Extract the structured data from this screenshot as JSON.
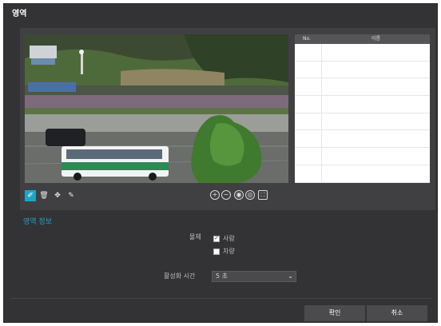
{
  "dialog": {
    "title": "영역"
  },
  "table": {
    "headers": [
      "No.",
      "이름"
    ],
    "rows": [
      [
        "",
        ""
      ],
      [
        "",
        ""
      ],
      [
        "",
        ""
      ],
      [
        "",
        ""
      ],
      [
        "",
        ""
      ],
      [
        "",
        ""
      ],
      [
        "",
        ""
      ],
      [
        "",
        ""
      ]
    ]
  },
  "toolbar": {
    "draw_icon": "✐",
    "delete_icon": "🗑",
    "move_icon": "✥",
    "paint_icon": "✎",
    "zoom_in_icon": "+",
    "zoom_out_icon": "−",
    "focus_in_icon": "◉",
    "focus_out_icon": "◎",
    "fit_icon": "⛶"
  },
  "info": {
    "section_title": "영역 정보",
    "object_label": "물체",
    "options": [
      {
        "label": "사람",
        "checked": true,
        "mark": "✓"
      },
      {
        "label": "차량",
        "checked": false,
        "mark": ""
      }
    ],
    "duration_label": "활성화 시간",
    "duration_value": "5 초",
    "duration_arrow": "⌄"
  },
  "footer": {
    "confirm_label": "확인",
    "cancel_label": "취소"
  },
  "colors": {
    "accent": "#1fa4c7",
    "dialog_bg": "#333335",
    "panel_bg": "#404042"
  }
}
